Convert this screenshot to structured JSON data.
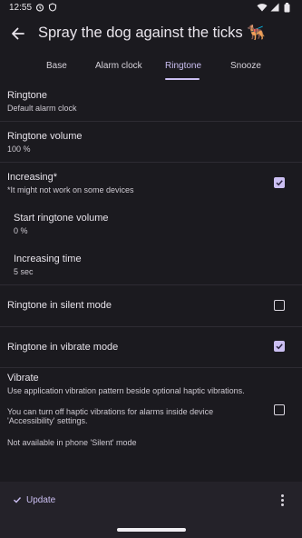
{
  "status_bar": {
    "time": "12:55",
    "left_icons": [
      "alarm-clock-icon",
      "shield-icon"
    ],
    "right_icons": [
      "wifi-icon",
      "cellular-icon",
      "battery-icon"
    ]
  },
  "app_bar": {
    "title": "Spray the dog against the ticks 🐕‍🦺"
  },
  "tabs": [
    {
      "label": "Base"
    },
    {
      "label": "Alarm clock"
    },
    {
      "label": "Ringtone",
      "active": true
    },
    {
      "label": "Snooze"
    }
  ],
  "settings": {
    "ringtone": {
      "title": "Ringtone",
      "value": "Default alarm clock"
    },
    "ringtone_volume": {
      "title": "Ringtone volume",
      "value": "100 %"
    },
    "increasing": {
      "title": "Increasing*",
      "note": "*It might not work on some devices",
      "checked": true
    },
    "start_volume": {
      "title": "Start ringtone volume",
      "value": "0 %"
    },
    "increasing_time": {
      "title": "Increasing time",
      "value": "5 sec"
    },
    "silent_mode": {
      "title": "Ringtone in silent mode",
      "checked": false
    },
    "vibrate_mode": {
      "title": "Ringtone in vibrate mode",
      "checked": true
    },
    "vibrate": {
      "title": "Vibrate",
      "description_1": "Use application vibration pattern beside optional haptic vibrations.",
      "description_2": "You can turn off haptic vibrations for alarms inside device 'Accessibility' settings.",
      "note": "Not available in phone 'Silent' mode",
      "checked": false
    }
  },
  "bottom_bar": {
    "update_label": "Update"
  },
  "colors": {
    "accent": "#cbbff2",
    "background": "#1b1a1f",
    "bottom_bar": "#242229"
  }
}
